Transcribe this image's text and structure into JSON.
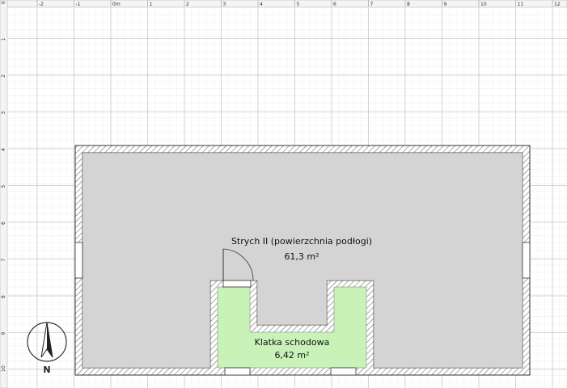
{
  "rulers": {
    "top_labels": [
      "-2",
      "-1",
      "0m",
      "1",
      "2",
      "3",
      "4",
      "5",
      "6",
      "7",
      "8",
      "9",
      "10",
      "11",
      "12"
    ],
    "left_labels": [
      "0",
      "1",
      "2",
      "3",
      "4",
      "5",
      "6",
      "7",
      "8",
      "9",
      "10"
    ]
  },
  "rooms": [
    {
      "name": "Strych II (powierzchnia podłogi)",
      "area": "61,3 m²",
      "color": "#d4d4d4"
    },
    {
      "name": "Klatka schodowa",
      "area": "6,42 m²",
      "color": "#c9f2b8"
    }
  ],
  "compass": {
    "label": "N"
  },
  "colors": {
    "grid_minor": "#e8e8e8",
    "grid_major": "#c8c8c8",
    "wall": "#555555"
  }
}
